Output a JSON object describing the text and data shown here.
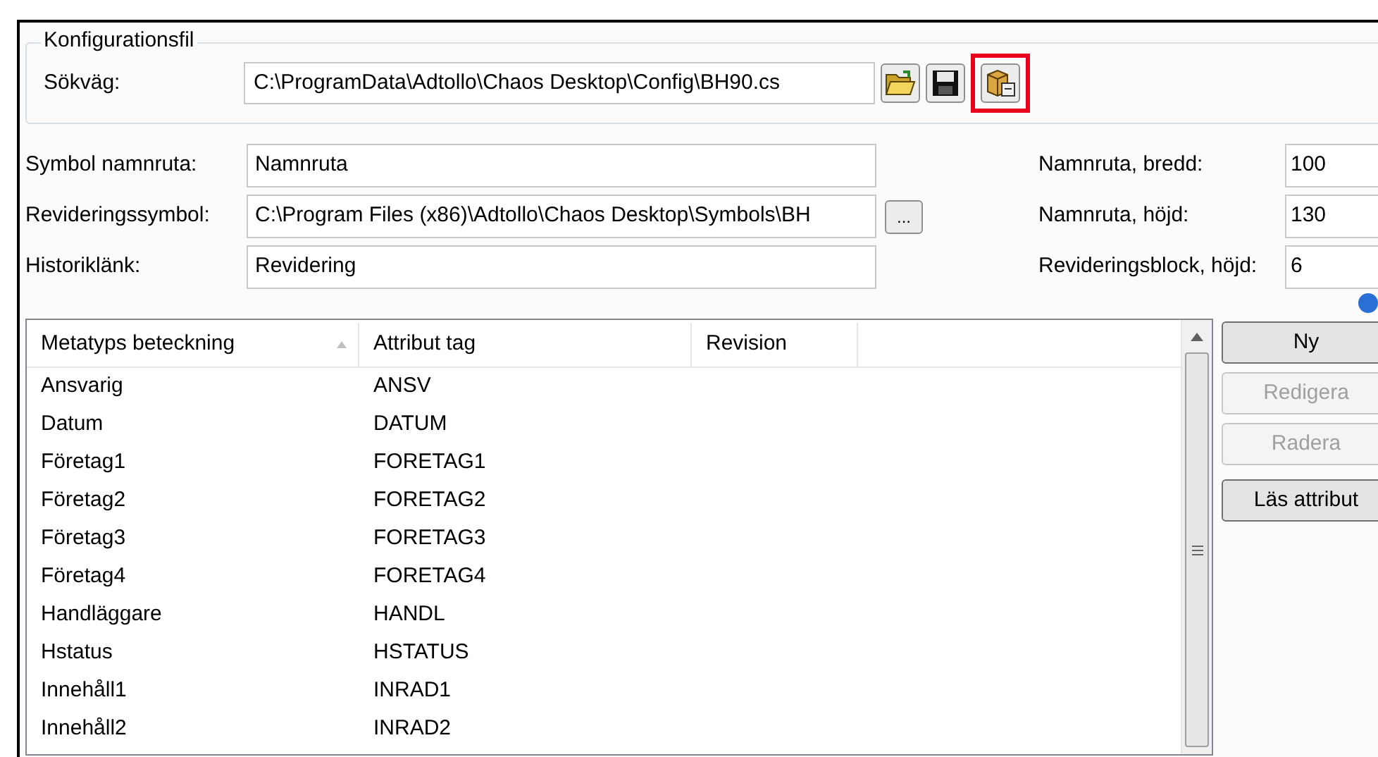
{
  "config_group": {
    "title": "Konfigurationsfil",
    "path_label": "Sökväg:",
    "path_value": "C:\\ProgramData\\Adtollo\\Chaos Desktop\\Config\\BH90.cs",
    "tools": [
      {
        "kind": "open",
        "highlighted": false
      },
      {
        "kind": "save",
        "highlighted": false
      },
      {
        "kind": "export",
        "highlighted": true
      }
    ]
  },
  "left_fields": [
    {
      "label": "Symbol namnruta:",
      "value": "Namnruta",
      "browse": false
    },
    {
      "label": "Revideringssymbol:",
      "value": "C:\\Program Files (x86)\\Adtollo\\Chaos Desktop\\Symbols\\BH",
      "browse": true,
      "browse_label": "..."
    },
    {
      "label": "Historiklänk:",
      "value": "Revidering",
      "browse": false
    }
  ],
  "right_fields": [
    {
      "label": "Namnruta, bredd:",
      "value": "100"
    },
    {
      "label": "Namnruta, höjd:",
      "value": "130"
    },
    {
      "label": "Revideringsblock, höjd:",
      "value": "6"
    }
  ],
  "table": {
    "columns": [
      {
        "label": "Metatyps beteckning",
        "sorted": true
      },
      {
        "label": "Attribut tag",
        "sorted": false
      },
      {
        "label": "Revision",
        "sorted": false
      }
    ],
    "rows": [
      [
        "Ansvarig",
        "ANSV"
      ],
      [
        "Datum",
        "DATUM"
      ],
      [
        "Företag1",
        "FORETAG1"
      ],
      [
        "Företag2",
        "FORETAG2"
      ],
      [
        "Företag3",
        "FORETAG3"
      ],
      [
        "Företag4",
        "FORETAG4"
      ],
      [
        "Handläggare",
        "HANDL"
      ],
      [
        "Hstatus",
        "HSTATUS"
      ],
      [
        "Innehåll1",
        "INRAD1"
      ],
      [
        "Innehåll2",
        "INRAD2"
      ]
    ]
  },
  "buttons": [
    {
      "label": "Ny",
      "disabled": false
    },
    {
      "label": "Redigera",
      "disabled": true
    },
    {
      "label": "Radera",
      "disabled": true
    },
    {
      "label": "Läs attribut",
      "disabled": false
    }
  ]
}
